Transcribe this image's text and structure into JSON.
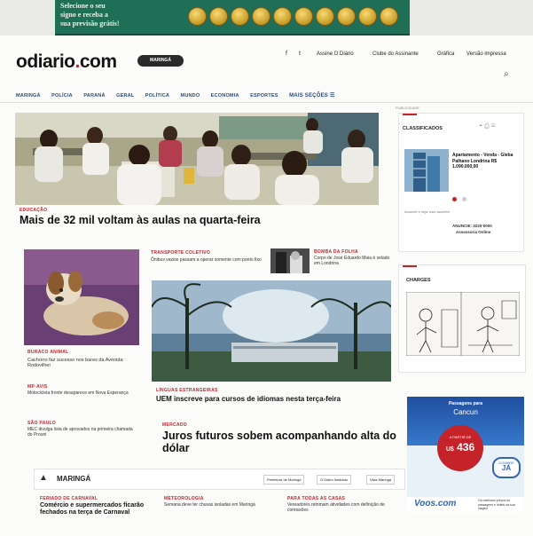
{
  "banner": {
    "line1": "Selecione o seu",
    "line2": "signo e receba a",
    "line3": "sua previsão grátis!"
  },
  "logo": {
    "main": "odiario",
    "dot": ".",
    "tld": "com"
  },
  "edition": "MARINGÁ",
  "top_links": [
    "Assine O Diário",
    "Clube do Assinante",
    "Gráfica",
    "Versão impressa"
  ],
  "social": [
    "f",
    "t"
  ],
  "nav": [
    "MARINGÁ",
    "POLÍCIA",
    "PARANÁ",
    "GERAL",
    "POLÍTICA",
    "MUNDO",
    "ECONOMIA",
    "ESPORTES",
    "MAIS SEÇÕES ☰"
  ],
  "hero": {
    "kicker": "EDUCAÇÃO",
    "title": "Mais de 32 mil voltam às aulas na quarta-feira"
  },
  "col_left": {
    "dog_kicker": "BURACO ANIMAL",
    "dog_title": "Cachorro faz sucesso nos bares da Avenida Rodovilhei",
    "item2_kicker": "MP-AVIS",
    "item2_title": "Motocicleta fronte desaparece em Nova Esperança",
    "item3_kicker": "SÃO PAULO",
    "item3_title": "MEC divulga lista de aprovados na primeira chamada do Prouni"
  },
  "col_mid": {
    "item1_kicker": "TRANSPORTE COLETIVO",
    "item1_title": "Ônibus vazios passam a operar somente com ponto fixo",
    "item2_kicker": "BOMBA DA FOLHA",
    "item2_title": "Corpo de José Eduardo Maia é velado em Londrina",
    "uem_kicker": "LÍNGUAS ESTRANGEIRAS",
    "uem_title": "UEM inscreve para cursos de idiomas nesta terça-feira",
    "juros_kicker": "MERCADO",
    "juros_title": "Juros futuros sobem acompanhando alta do dólar"
  },
  "section": {
    "title": "MARINGÁ",
    "tags": [
      "Prefeitura de Maringá",
      "O Diário Ilustrado",
      "Vilas Maringá"
    ],
    "items": [
      {
        "kicker": "FERIADO DE CARNAVAL",
        "title": "Comércio e supermercados ficarão fechados na terça de Carnaval"
      },
      {
        "kicker": "METEOROLOGIA",
        "title": "Semana deve ter chuvas isoladas em Maringá"
      },
      {
        "kicker": "PARA TODAS AS CASAS",
        "title": "Vereadores retomam atividades com definição de comissões"
      }
    ]
  },
  "classificados": {
    "label": "CLASSIFICADOS",
    "small_label": "PUBLICIDADE",
    "title": "CLASSIFICADOS",
    "ad_text": "Apartamento - Venda - Gleba Palhano Londrina R$ 1.090.000,00",
    "footer1": "Anuncie e seja visto também",
    "footer2": "ANUNCIE: 3220-0000",
    "footer3": "Assessoria Online"
  },
  "charges": {
    "title": "CHARGES"
  },
  "voos": {
    "headline": "Passagens para",
    "dest": "Cancun",
    "apartir": "A PARTIR DE",
    "price": "436",
    "currency": "U$",
    "badge1": "COMPRE",
    "badge2": "JÁ",
    "brand": "Voos.com",
    "note": "Os melhores preços de passagens e hotéis da sua viagem"
  },
  "colors": {
    "brand_red": "#c4232a",
    "nav_blue": "#2c4b7a",
    "banner_green": "#1f6e56"
  }
}
